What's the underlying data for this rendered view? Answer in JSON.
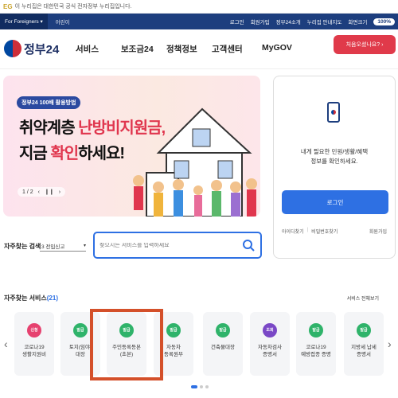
{
  "notice": {
    "mark": "EG",
    "text": "이 누리집은 대한민국 공식 전자정부 누리집입니다."
  },
  "topbar": {
    "lang": "For Foreigners",
    "lang_dd": "▾",
    "lang2": "어린이",
    "links": [
      "로그인",
      "회원가입",
      "정부24소개",
      "누리집 안내지도",
      "화면크기"
    ],
    "zoom": "100%"
  },
  "header": {
    "logo_text": "정부24",
    "nav": [
      "서비스",
      "보조금24",
      "정책정보",
      "고객센터",
      "MyGOV"
    ],
    "cta": "처음오셨나요? ›"
  },
  "banner": {
    "badge": "정부24 100배 활용방법",
    "line1_a": "취약계층 ",
    "line1_b": "난방비지원금,",
    "line2_a": "지금 ",
    "line2_b": "확인",
    "line2_c": "하세요!",
    "pager": "1 / 2",
    "prev": "‹",
    "next": "›",
    "pause": "❙❙"
  },
  "login_card": {
    "text1": "내게 필요한 민원/생활/혜택",
    "text2": "정보를 확인하세요.",
    "button": "로그인",
    "links": [
      "아이디찾기",
      "비밀번호찾기",
      "회원가입"
    ]
  },
  "search": {
    "label": "자주찾는 검색",
    "select": "3 전입신고",
    "placeholder": "찾으시는 서비스를 입력하세요"
  },
  "services": {
    "title": "자주찾는 서비스",
    "count": "(21)",
    "see_all": "서비스 전체보기",
    "items": [
      {
        "badge": "신청",
        "label1": "코로나19",
        "label2": "생활지원비",
        "color": "#e6416f"
      },
      {
        "badge": "발급",
        "label1": "토지(임야)",
        "label2": "대장",
        "color": "#2fb36a"
      },
      {
        "badge": "발급",
        "label1": "주민등록등본",
        "label2": "(초본)",
        "color": "#2fb36a"
      },
      {
        "badge": "발급",
        "label1": "자동차",
        "label2": "등록원부",
        "color": "#2fb36a"
      },
      {
        "badge": "발급",
        "label1": "건축물대장",
        "label2": "",
        "color": "#2fb36a"
      },
      {
        "badge": "조회",
        "label1": "자동차검사",
        "label2": "증명서",
        "color": "#7a48c6"
      },
      {
        "badge": "발급",
        "label1": "코로나19",
        "label2": "예방접종 증명",
        "color": "#2fb36a"
      },
      {
        "badge": "발급",
        "label1": "지방세 납세",
        "label2": "증명서",
        "color": "#2fb36a"
      }
    ]
  },
  "colors": {
    "primary": "#2e70e3",
    "navy": "#1d3e7e",
    "accent": "#e03a4a"
  }
}
